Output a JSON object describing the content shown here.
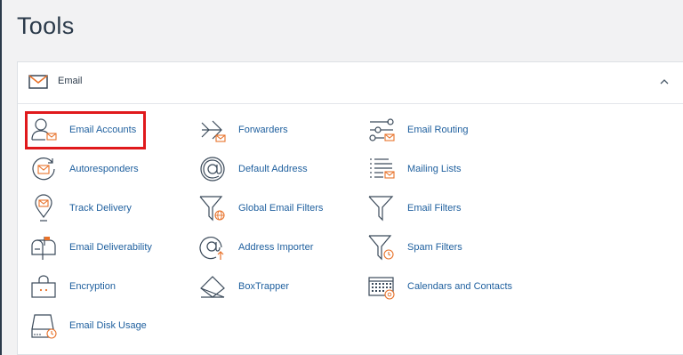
{
  "page": {
    "title": "Tools"
  },
  "email_section": {
    "title": "Email",
    "tools": [
      {
        "label": "Email Accounts",
        "icon": "email-accounts-icon"
      },
      {
        "label": "Forwarders",
        "icon": "forwarders-icon"
      },
      {
        "label": "Email Routing",
        "icon": "email-routing-icon"
      },
      {
        "label": "Autoresponders",
        "icon": "autoresponders-icon"
      },
      {
        "label": "Default Address",
        "icon": "default-address-icon"
      },
      {
        "label": "Mailing Lists",
        "icon": "mailing-lists-icon"
      },
      {
        "label": "Track Delivery",
        "icon": "track-delivery-icon"
      },
      {
        "label": "Global Email Filters",
        "icon": "global-email-filters-icon"
      },
      {
        "label": "Email Filters",
        "icon": "email-filters-icon"
      },
      {
        "label": "Email Deliverability",
        "icon": "email-deliverability-icon"
      },
      {
        "label": "Address Importer",
        "icon": "address-importer-icon"
      },
      {
        "label": "Spam Filters",
        "icon": "spam-filters-icon"
      },
      {
        "label": "Encryption",
        "icon": "encryption-icon"
      },
      {
        "label": "BoxTrapper",
        "icon": "boxtrapper-icon"
      },
      {
        "label": "Calendars and Contacts",
        "icon": "calendars-contacts-icon"
      },
      {
        "label": "Email Disk Usage",
        "icon": "email-disk-usage-icon"
      }
    ]
  },
  "colors": {
    "title": "#2b3a4a",
    "link": "#1e5f9e",
    "icon_stroke": "#3b4a5a",
    "accent": "#e8722a",
    "highlight": "#e0191c"
  }
}
